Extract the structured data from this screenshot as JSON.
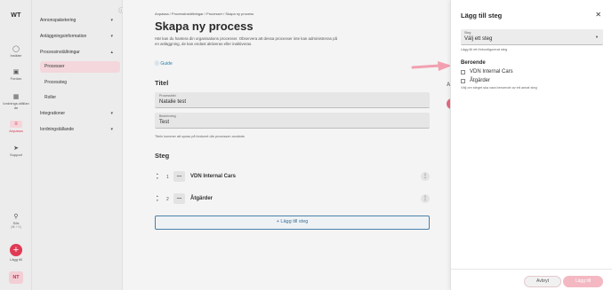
{
  "rail": {
    "logo": "WT",
    "items": [
      {
        "label": "Insikter",
        "icon": "lightbulb-icon"
      },
      {
        "label": "Fordon",
        "icon": "car-icon"
      },
      {
        "label": "Iordnings-ställande",
        "icon": "wrench-icon"
      },
      {
        "label": "Anpassa",
        "icon": "settings-sliders-icon"
      },
      {
        "label": "Support",
        "icon": "support-icon"
      },
      {
        "label": "Sök",
        "icon": "search-icon"
      }
    ],
    "search_shortcut": "(⌘ + K)",
    "add_label": "Lägg till",
    "add_symbol": "+",
    "avatar": "NT"
  },
  "sidebar": {
    "items": [
      {
        "label": "Annonspaketering"
      },
      {
        "label": "Anläggningsinformation"
      },
      {
        "label": "Processinställningar"
      },
      {
        "label": "Integrationer"
      },
      {
        "label": "Iordningställande"
      }
    ],
    "sub_items": [
      {
        "label": "Processer"
      },
      {
        "label": "Processteg"
      },
      {
        "label": "Roller"
      }
    ]
  },
  "main": {
    "breadcrumb": "Anpassa / Processinställningar / Processer / Skapa ny process",
    "title": "Skapa ny process",
    "description": "Här kan du hantera din organisations processer. Observera att dessa processer inte kan administreras på en anläggning, de kan endast aktiveras eller inaktiveras.",
    "guide_label": "Guide",
    "title_section": "Titel",
    "process_field": {
      "label": "Processtitel",
      "value": "Natalie test"
    },
    "description_field": {
      "label": "Beskrivning",
      "value": "Test"
    },
    "field_hint": "Titeln kommer att synas på fordonet där processen används",
    "steps_section": "Steg",
    "steps": [
      {
        "number": "1",
        "name": "VDN Internal Cars"
      },
      {
        "number": "2",
        "name": "Åtgärder"
      }
    ],
    "add_step_label": "+ Lägg till steg",
    "peek_text": "A"
  },
  "drawer": {
    "title": "Lägg till steg",
    "select": {
      "label": "Steg",
      "value": "Välj ett steg"
    },
    "select_hint": "Lägg till ett förkonfigurerat steg",
    "dependent_title": "Beroende",
    "dependencies": [
      {
        "label": "VDN Internal Cars",
        "checked": false
      },
      {
        "label": "Åtgärder",
        "checked": false
      }
    ],
    "dependent_hint": "Välj om steget ska vara beroende av ett annat steg",
    "cancel_label": "Avbryt",
    "add_label": "Lägg till"
  },
  "colors": {
    "accent": "#e03a55",
    "accent_light": "#f4b8c3",
    "link": "#2a7aa8",
    "arrow": "#f2a0b0"
  }
}
